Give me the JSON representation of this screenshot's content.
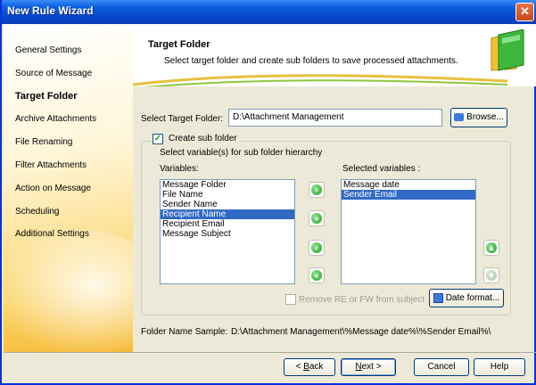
{
  "window": {
    "title": "New Rule Wizard",
    "close_glyph": "✕"
  },
  "sidebar": {
    "items": [
      {
        "label": "General Settings"
      },
      {
        "label": "Source of Message"
      },
      {
        "label": "Target Folder"
      },
      {
        "label": "Archive Attachments"
      },
      {
        "label": "File Renaming"
      },
      {
        "label": "Filter Attachments"
      },
      {
        "label": "Action on Message"
      },
      {
        "label": "Scheduling"
      },
      {
        "label": "Additional Settings"
      }
    ],
    "active_index": 2
  },
  "header": {
    "title": "Target Folder",
    "subtitle": "Select target folder and create sub folders to save processed attachments."
  },
  "target": {
    "label": "Select Target Folder:",
    "value": "D:\\Attachment Management",
    "browse_label": "Browse..."
  },
  "subfolder": {
    "checkbox_label": "Create sub folder",
    "checked": true,
    "hint": "Select variable(s) for sub folder hierarchy",
    "variables_label": "Variables:",
    "selected_label": "Selected variables :",
    "variables": [
      {
        "label": "Message Folder",
        "selected": false
      },
      {
        "label": "File Name",
        "selected": false
      },
      {
        "label": "Sender Name",
        "selected": false
      },
      {
        "label": "Recipient Name",
        "selected": true
      },
      {
        "label": "Recipient Email",
        "selected": false
      },
      {
        "label": "Message Subject",
        "selected": false
      }
    ],
    "selected_variables": [
      {
        "label": "Message date",
        "selected": false
      },
      {
        "label": "Sender Email",
        "selected": true
      }
    ],
    "remove_re_label": "Remove RE or FW from subject",
    "date_format_label": "Date format..."
  },
  "sample": {
    "label": "Folder Name Sample:",
    "value": "D:\\Attachment Management\\%Message date%\\%Sender Email%\\"
  },
  "buttons": {
    "back_prefix": "< ",
    "back_key": "B",
    "back_rest": "ack",
    "next_key": "N",
    "next_rest": "ext >",
    "cancel": "Cancel",
    "help": "Help"
  },
  "colors": {
    "selection": "#316ac5",
    "titlebar": "#0a5ee0",
    "accent_green": "#1e9a1e"
  }
}
